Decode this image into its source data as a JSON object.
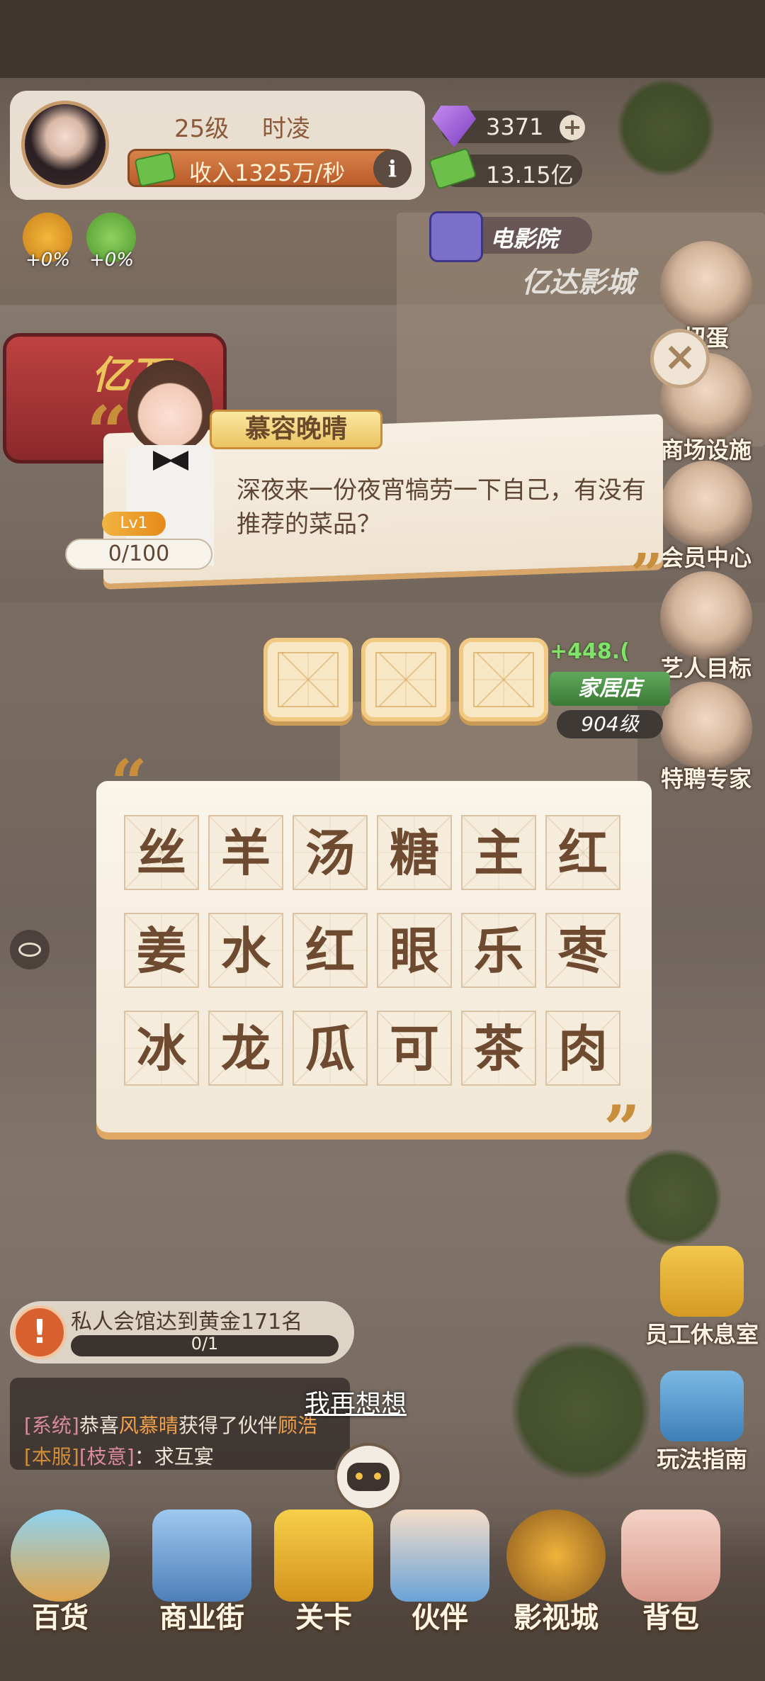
{
  "player": {
    "level": "25级",
    "name": "时凌",
    "income": "收入1325万/秒",
    "boost_like": "+0%",
    "boost_cash": "+0%"
  },
  "currency": {
    "gems": "3371",
    "cash": "13.15亿"
  },
  "location": {
    "cinema_label": "电影院",
    "cinema_sign": "亿达影城",
    "store_label": "家居店",
    "store_level": "904级",
    "income_float": "+448.("
  },
  "side_menu": [
    {
      "label": "扭蛋"
    },
    {
      "label": "商场设施"
    },
    {
      "label": "会员中心"
    },
    {
      "label": "艺人目标"
    },
    {
      "label": "特聘专家"
    }
  ],
  "side_bottom": [
    {
      "label": "员工休息室"
    },
    {
      "label": "玩法指南"
    }
  ],
  "promo": {
    "text": "亿万"
  },
  "dialog": {
    "speaker": "慕容晚晴",
    "text": "深夜来一份夜宵犒劳一下自己，有没有推荐的菜品？",
    "level": "Lv1",
    "affinity": "0/100"
  },
  "puzzle": {
    "slots": 3,
    "chars": [
      "丝",
      "羊",
      "汤",
      "糖",
      "主",
      "红",
      "姜",
      "水",
      "红",
      "眼",
      "乐",
      "枣",
      "冰",
      "龙",
      "瓜",
      "可",
      "茶",
      "肉"
    ]
  },
  "task": {
    "text": "私人会馆达到黄金171名",
    "progress": "0/1",
    "progress_value": 0
  },
  "rethink": "我再想想",
  "chat": {
    "line1": {
      "tag": "[系统]",
      "pre": "恭喜",
      "name": "风慕晴",
      "mid": "获得了伙伴",
      "partner": "顾浩"
    },
    "line2": {
      "tag1": "[本服]",
      "tag2": "[枝意]",
      "msg": "：求互宴"
    }
  },
  "nav": [
    {
      "label": "百货"
    },
    {
      "label": "商业街"
    },
    {
      "label": "关卡"
    },
    {
      "label": "伙伴"
    },
    {
      "label": "影视城"
    },
    {
      "label": "背包"
    }
  ],
  "colors": {
    "accent": "#c98e3c",
    "char_text": "#6d4a30",
    "panel": "#fbf5ea"
  }
}
